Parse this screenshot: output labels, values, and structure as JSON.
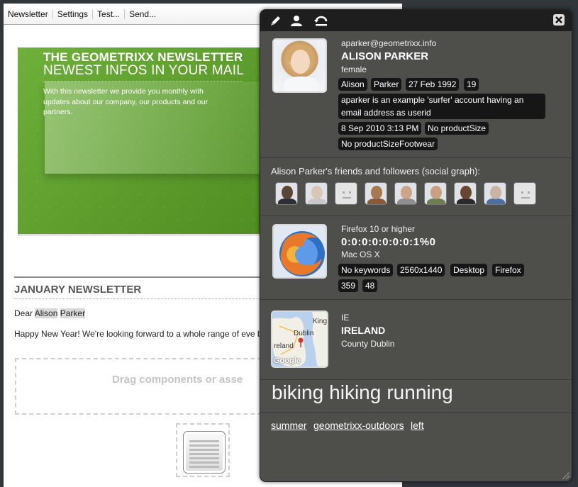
{
  "toolbar": {
    "items": [
      "Newsletter",
      "Settings",
      "Test...",
      "Send..."
    ]
  },
  "newsletter": {
    "banner_title": "THE GEOMETRIXX NEWSLETTER",
    "banner_subtitle": "NEWEST INFOS IN YOUR MAIL",
    "banner_text": "With this newsletter we provide you monthly with updates about our company, our products and our partners.",
    "heading": "JANUARY NEWSLETTER",
    "dear": "Dear",
    "first_name": "Alison",
    "last_name": "Parker",
    "body": "Happy New Year! We're looking forward to a whole range of eve bang. Hope you enjoy them all.",
    "dropzone": "Drag components or asse"
  },
  "profile": {
    "email": "aparker@geometrixx.info",
    "name": "ALISON PARKER",
    "gender": "female",
    "first_name": "Alison",
    "last_name": "Parker",
    "birthday": "27 Feb 1992",
    "age": "19",
    "about": "aparker is an example 'surfer' account having an email address as userid",
    "date": "8 Sep 2010 3:13 PM",
    "product_size": "No productSize",
    "product_size_footwear": "No productSizeFootwear"
  },
  "social": {
    "title": "Alison Parker's friends and followers (social graph):",
    "friends": [
      "person",
      "person",
      "blank",
      "person",
      "person",
      "person",
      "person",
      "person",
      "blank"
    ]
  },
  "browser": {
    "name": "Firefox 10 or higher",
    "ip": "0:0:0:0:0:0:0:1%0",
    "os": "Mac OS X",
    "keywords": "No keywords",
    "resolution": "2560x1440",
    "device": "Desktop",
    "browser": "Firefox",
    "chip1": "359",
    "chip2": "48"
  },
  "geo": {
    "code": "IE",
    "country": "IRELAND",
    "county": "County Dublin",
    "map_labels": {
      "city": "Dublin",
      "region": "reland",
      "king": "King",
      "brand": "Google"
    }
  },
  "tags": [
    "biking",
    "hiking",
    "running"
  ],
  "segments": [
    "summer",
    "geometrixx-outdoors",
    "left"
  ],
  "colors": {
    "panel": "#4e4e4b",
    "chip": "#161616",
    "banner": "#5d9f2e"
  },
  "icons": [
    "edit-icon",
    "user-icon",
    "reset-icon",
    "close-icon"
  ]
}
